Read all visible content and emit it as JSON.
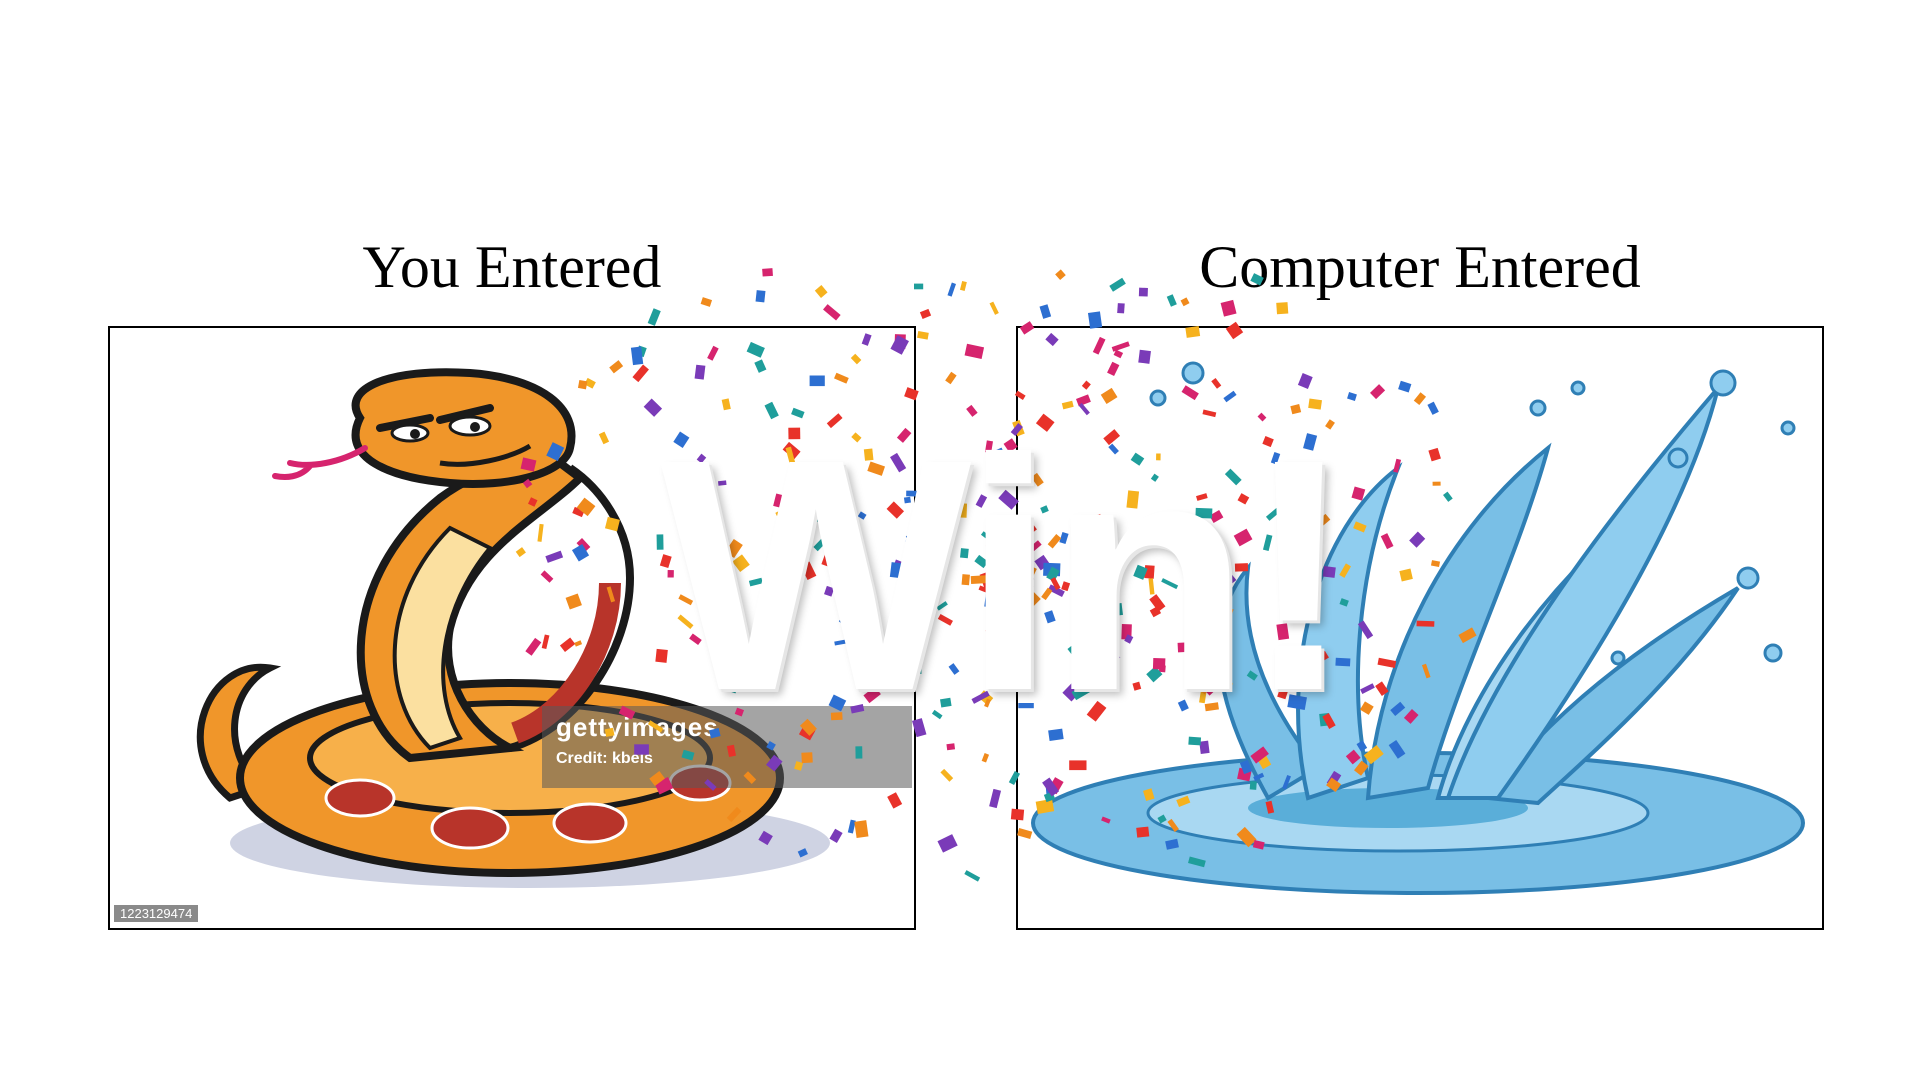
{
  "result": {
    "left_caption": "You Entered",
    "right_caption": "Computer Entered",
    "outcome_text": "Win!"
  },
  "left_image": {
    "subject": "snake",
    "watermark_brand": "gettyimages",
    "watermark_credit": "Credit: kbeis",
    "stock_id": "1223129474"
  },
  "right_image": {
    "subject": "water"
  },
  "colors": {
    "snake_orange": "#f0962a",
    "snake_red": "#b8342a",
    "snake_belly": "#fbe0a0",
    "water_blue": "#79bfe6",
    "water_dark": "#2f7fb5",
    "confetti": [
      "#e8322a",
      "#2d6fd1",
      "#f6b21e",
      "#d6246e",
      "#1f9e9b",
      "#f08a1c",
      "#7a3bb8"
    ]
  }
}
